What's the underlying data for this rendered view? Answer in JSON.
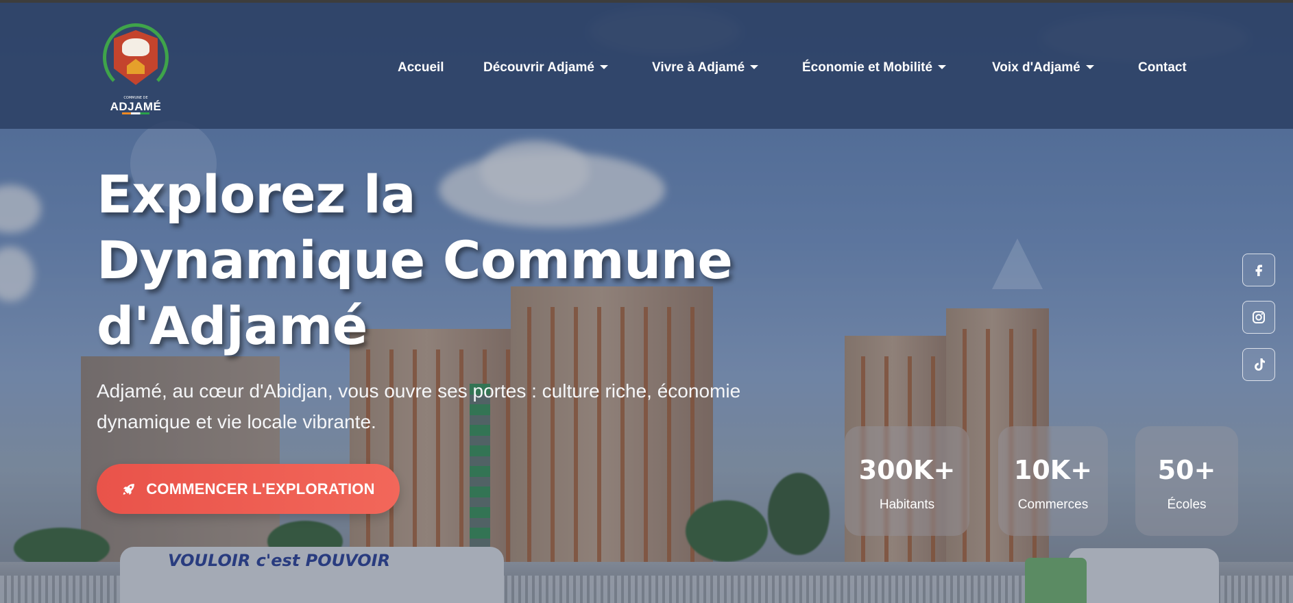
{
  "brand": {
    "tiny_text": "COMMUNE DE",
    "name": "ADJAMÉ"
  },
  "nav": {
    "items": [
      {
        "label": "Accueil",
        "dropdown": false
      },
      {
        "label": "Découvrir Adjamé",
        "dropdown": true
      },
      {
        "label": "Vivre à Adjamé",
        "dropdown": true
      },
      {
        "label": "Économie et Mobilité",
        "dropdown": true
      },
      {
        "label": "Voix d'Adjamé",
        "dropdown": true
      },
      {
        "label": "Contact",
        "dropdown": false
      }
    ]
  },
  "hero": {
    "title_line1": "Explorez la",
    "title_line2": "Dynamique Commune",
    "title_line3": "d'Adjamé",
    "subtitle": "Adjamé, au cœur d'Abidjan, vous ouvre ses portes : culture riche, économie dynamique et vie locale vibrante.",
    "cta_label": "COMMENCER L'EXPLORATION",
    "cta_icon": "rocket-icon",
    "background_text": "VOULOIR c'est POUVOIR"
  },
  "stats": [
    {
      "value": "300K+",
      "label": "Habitants"
    },
    {
      "value": "10K+",
      "label": "Commerces"
    },
    {
      "value": "50+",
      "label": "Écoles"
    }
  ],
  "social": [
    {
      "name": "facebook-icon"
    },
    {
      "name": "instagram-icon"
    },
    {
      "name": "tiktok-icon"
    }
  ],
  "colors": {
    "header_bg": "#2c4064",
    "cta_accent": "#ef5e52",
    "text": "#ffffff"
  }
}
